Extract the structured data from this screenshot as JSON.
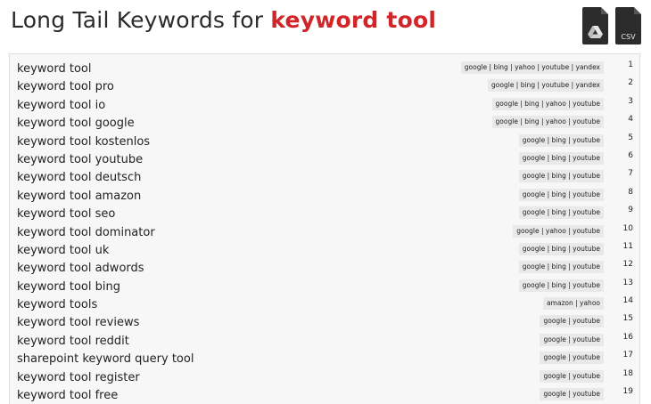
{
  "header": {
    "title_prefix": "Long Tail Keywords for ",
    "title_keyword": "keyword tool",
    "drive_label": "",
    "csv_label": "CSV"
  },
  "rows": [
    {
      "keyword": "keyword tool",
      "engines": "google | bing | yahoo | youtube | yandex",
      "num": "1"
    },
    {
      "keyword": "keyword tool pro",
      "engines": "google | bing | youtube | yandex",
      "num": "2"
    },
    {
      "keyword": "keyword tool io",
      "engines": "google | bing | yahoo | youtube",
      "num": "3"
    },
    {
      "keyword": "keyword tool google",
      "engines": "google | bing | yahoo | youtube",
      "num": "4"
    },
    {
      "keyword": "keyword tool kostenlos",
      "engines": "google | bing | youtube",
      "num": "5"
    },
    {
      "keyword": "keyword tool youtube",
      "engines": "google | bing | youtube",
      "num": "6"
    },
    {
      "keyword": "keyword tool deutsch",
      "engines": "google | bing | youtube",
      "num": "7"
    },
    {
      "keyword": "keyword tool amazon",
      "engines": "google | bing | youtube",
      "num": "8"
    },
    {
      "keyword": "keyword tool seo",
      "engines": "google | bing | youtube",
      "num": "9"
    },
    {
      "keyword": "keyword tool dominator",
      "engines": "google | yahoo | youtube",
      "num": "10"
    },
    {
      "keyword": "keyword tool uk",
      "engines": "google | bing | youtube",
      "num": "11"
    },
    {
      "keyword": "keyword tool adwords",
      "engines": "google | bing | youtube",
      "num": "12"
    },
    {
      "keyword": "keyword tool bing",
      "engines": "google | bing | youtube",
      "num": "13"
    },
    {
      "keyword": "keyword tools",
      "engines": "amazon | yahoo",
      "num": "14"
    },
    {
      "keyword": "keyword tool reviews",
      "engines": "google | youtube",
      "num": "15"
    },
    {
      "keyword": "keyword tool reddit",
      "engines": "google | youtube",
      "num": "16"
    },
    {
      "keyword": "sharepoint keyword query tool",
      "engines": "google | youtube",
      "num": "17"
    },
    {
      "keyword": "keyword tool register",
      "engines": "google | youtube",
      "num": "18"
    },
    {
      "keyword": "keyword tool free",
      "engines": "google | youtube",
      "num": "19"
    }
  ],
  "colors": {
    "accent": "#d0262a",
    "list_bg": "#f7f7f7",
    "badge_bg": "#e9e9e9"
  },
  "icons": {
    "drive_export": "google-drive-icon",
    "csv_export": "csv-file-icon"
  }
}
